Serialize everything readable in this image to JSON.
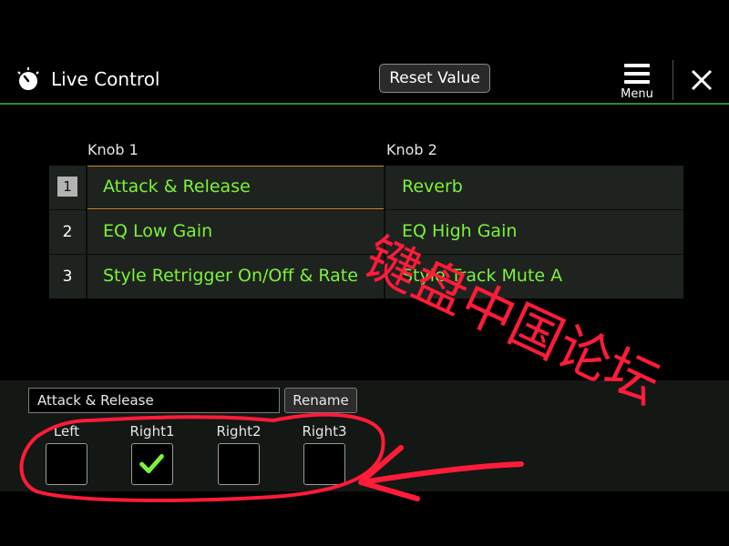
{
  "header": {
    "title": "Live Control",
    "reset_label": "Reset Value",
    "menu_label": "Menu"
  },
  "table": {
    "columns": [
      "Knob 1",
      "Knob 2"
    ],
    "rows": [
      {
        "num": "1",
        "knob1": "Attack & Release",
        "knob2": "Reverb",
        "selected": true
      },
      {
        "num": "2",
        "knob1": "EQ Low Gain",
        "knob2": "EQ High Gain"
      },
      {
        "num": "3",
        "knob1": "Style Retrigger On/Off & Rate",
        "knob2": "Style Track Mute A"
      }
    ]
  },
  "bottom": {
    "name_value": "Attack & Release",
    "rename_label": "Rename",
    "parts": [
      {
        "label": "Left",
        "checked": false
      },
      {
        "label": "Right1",
        "checked": true
      },
      {
        "label": "Right2",
        "checked": false
      },
      {
        "label": "Right3",
        "checked": false
      }
    ]
  },
  "watermark": "键盘中国论坛",
  "colors": {
    "accent_green": "#7cf23a",
    "header_line": "#2f8a2f",
    "selection_border": "#d08a2a",
    "annotation_red": "#ff1b3a"
  },
  "icons": [
    "live-control-knob-icon",
    "menu-icon",
    "close-icon",
    "checkmark-icon"
  ]
}
